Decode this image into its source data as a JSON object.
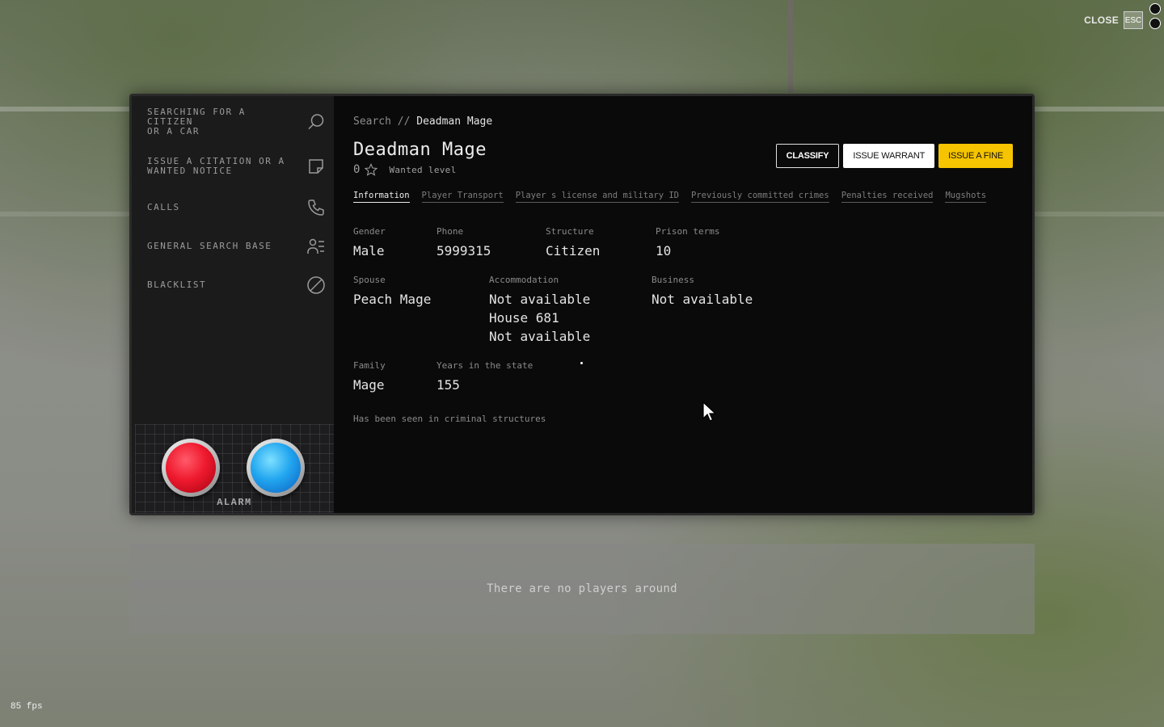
{
  "top_bar": {
    "close_label": "CLOSE",
    "esc_key": "ESC"
  },
  "sidebar": {
    "items": [
      {
        "label": "SEARCHING FOR A\nCITIZEN\nOR A CAR",
        "icon": "search-icon"
      },
      {
        "label": "ISSUE A CITATION OR A\nWANTED NOTICE",
        "icon": "note-icon"
      },
      {
        "label": "CALLS",
        "icon": "phone-icon"
      },
      {
        "label": "GENERAL SEARCH BASE",
        "icon": "user-list-icon"
      },
      {
        "label": "BLACKLIST",
        "icon": "block-icon"
      }
    ],
    "alarm": {
      "label": "ALARM",
      "red_color": "#ef1a2e",
      "blue_color": "#22a6ef"
    }
  },
  "breadcrumb": {
    "root": "Search",
    "separator": "//",
    "current": "Deadman Mage"
  },
  "profile": {
    "name": "Deadman Mage",
    "wanted_count": "0",
    "wanted_label": "Wanted level"
  },
  "actions": {
    "classify": "CLASSIFY",
    "issue_warrant": "ISSUE WARRANT",
    "issue_fine": "ISSUE A FINE",
    "fine_color": "#f6c400"
  },
  "tabs": [
    {
      "label": "Information",
      "active": true
    },
    {
      "label": "Player Transport",
      "active": false
    },
    {
      "label": "Player s license and military ID",
      "active": false
    },
    {
      "label": "Previously committed crimes",
      "active": false
    },
    {
      "label": "Penalties received",
      "active": false
    },
    {
      "label": "Mugshots",
      "active": false
    }
  ],
  "info": {
    "gender": {
      "label": "Gender",
      "value": "Male"
    },
    "phone": {
      "label": "Phone",
      "value": "5999315"
    },
    "structure": {
      "label": "Structure",
      "value": "Citizen"
    },
    "prison_terms": {
      "label": "Prison terms",
      "value": "10"
    },
    "spouse": {
      "label": "Spouse",
      "value": "Peach Mage"
    },
    "accommodation": {
      "label": "Accommodation",
      "value": "Not available\nHouse 681\nNot available"
    },
    "business": {
      "label": "Business",
      "value": "Not available"
    },
    "family": {
      "label": "Family",
      "value": "Mage"
    },
    "years": {
      "label": "Years in the state",
      "value": "155"
    },
    "note": "Has been seen in criminal structures"
  },
  "players": {
    "empty_text": "There are no players around"
  },
  "fps": "85 fps"
}
